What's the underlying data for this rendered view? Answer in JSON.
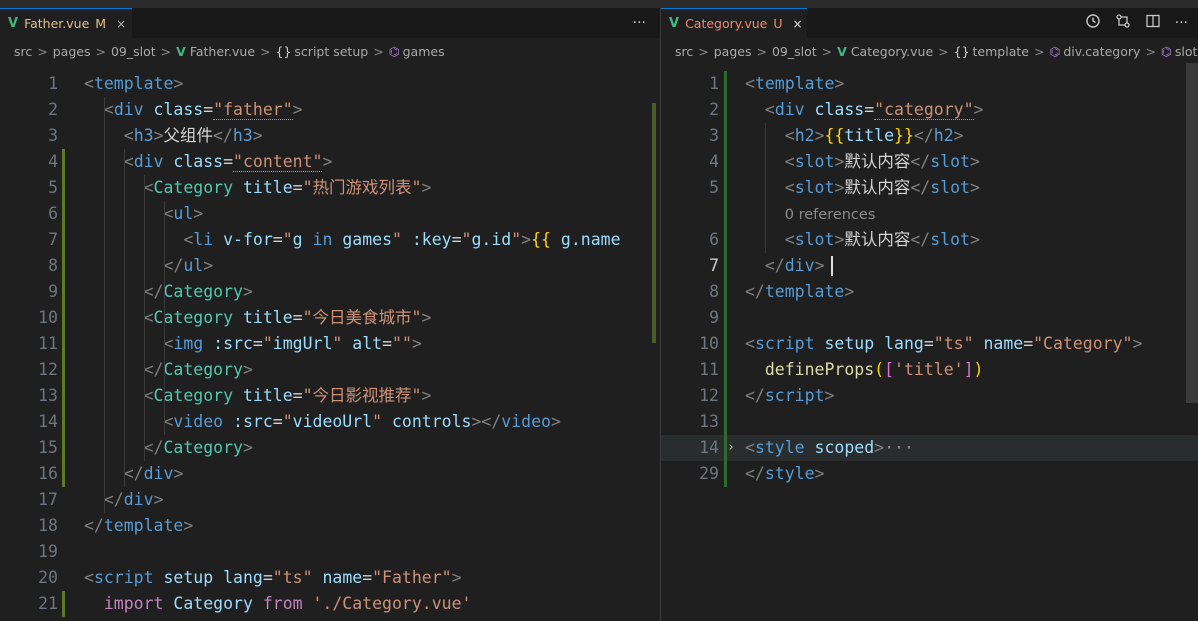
{
  "left": {
    "tab": {
      "name": "Father.vue",
      "flag": "M",
      "close": "×"
    },
    "actions": {
      "more": "···"
    },
    "breadcrumb": [
      "src",
      "pages",
      "09_slot",
      "Father.vue",
      "script setup",
      "games"
    ],
    "lines": [
      {
        "n": "1",
        "tokens": [
          [
            "<",
            "t-punc"
          ],
          [
            "template",
            "t-tag"
          ],
          [
            ">",
            "t-punc"
          ]
        ]
      },
      {
        "n": "2",
        "tokens": [
          [
            "  ",
            ""
          ],
          [
            "<",
            "t-punc"
          ],
          [
            "div",
            "t-tag"
          ],
          [
            " class",
            "t-attr"
          ],
          [
            "=",
            "t-txt"
          ],
          [
            "\"father\"",
            "t-str squiggle"
          ],
          [
            ">",
            "t-punc"
          ]
        ]
      },
      {
        "n": "3",
        "tokens": [
          [
            "    ",
            ""
          ],
          [
            "<",
            "t-punc"
          ],
          [
            "h3",
            "t-tag"
          ],
          [
            ">",
            "t-punc"
          ],
          [
            "父组件",
            "t-txt"
          ],
          [
            "</",
            "t-punc"
          ],
          [
            "h3",
            "t-tag"
          ],
          [
            ">",
            "t-punc"
          ]
        ]
      },
      {
        "n": "4",
        "tokens": [
          [
            "    ",
            ""
          ],
          [
            "<",
            "t-punc"
          ],
          [
            "div",
            "t-tag"
          ],
          [
            " class",
            "t-attr"
          ],
          [
            "=",
            "t-txt"
          ],
          [
            "\"content\"",
            "t-str squiggle"
          ],
          [
            ">",
            "t-punc"
          ]
        ]
      },
      {
        "n": "5",
        "tokens": [
          [
            "      ",
            ""
          ],
          [
            "<",
            "t-punc"
          ],
          [
            "Category",
            "t-comp"
          ],
          [
            " title",
            "t-attr"
          ],
          [
            "=",
            "t-txt"
          ],
          [
            "\"热门游戏列表\"",
            "t-str"
          ],
          [
            ">",
            "t-punc"
          ]
        ]
      },
      {
        "n": "6",
        "tokens": [
          [
            "        ",
            ""
          ],
          [
            "<",
            "t-punc"
          ],
          [
            "ul",
            "t-tag"
          ],
          [
            ">",
            "t-punc"
          ]
        ]
      },
      {
        "n": "7",
        "tokens": [
          [
            "          ",
            ""
          ],
          [
            "<",
            "t-punc"
          ],
          [
            "li",
            "t-tag"
          ],
          [
            " v-for",
            "t-attr"
          ],
          [
            "=",
            "t-txt"
          ],
          [
            "\"",
            "t-str"
          ],
          [
            "g",
            "t-attr"
          ],
          [
            " in ",
            "t-kw"
          ],
          [
            "games",
            "t-attr"
          ],
          [
            "\"",
            "t-str"
          ],
          [
            " :key",
            "t-attr"
          ],
          [
            "=",
            "t-txt"
          ],
          [
            "\"",
            "t-str"
          ],
          [
            "g.id",
            "t-attr"
          ],
          [
            "\"",
            "t-str"
          ],
          [
            ">",
            "t-punc"
          ],
          [
            "{{",
            "t-br1"
          ],
          [
            " g.name",
            "t-attr"
          ]
        ]
      },
      {
        "n": "8",
        "tokens": [
          [
            "        ",
            ""
          ],
          [
            "</",
            "t-punc"
          ],
          [
            "ul",
            "t-tag"
          ],
          [
            ">",
            "t-punc"
          ]
        ]
      },
      {
        "n": "9",
        "tokens": [
          [
            "      ",
            ""
          ],
          [
            "</",
            "t-punc"
          ],
          [
            "Category",
            "t-comp"
          ],
          [
            ">",
            "t-punc"
          ]
        ]
      },
      {
        "n": "10",
        "tokens": [
          [
            "      ",
            ""
          ],
          [
            "<",
            "t-punc"
          ],
          [
            "Category",
            "t-comp"
          ],
          [
            " title",
            "t-attr"
          ],
          [
            "=",
            "t-txt"
          ],
          [
            "\"今日美食城市\"",
            "t-str"
          ],
          [
            ">",
            "t-punc"
          ]
        ]
      },
      {
        "n": "11",
        "tokens": [
          [
            "        ",
            ""
          ],
          [
            "<",
            "t-punc"
          ],
          [
            "img",
            "t-tag"
          ],
          [
            " :src",
            "t-attr"
          ],
          [
            "=",
            "t-txt"
          ],
          [
            "\"",
            "t-str"
          ],
          [
            "imgUrl",
            "t-attr"
          ],
          [
            "\"",
            "t-str"
          ],
          [
            " alt",
            "t-attr"
          ],
          [
            "=",
            "t-txt"
          ],
          [
            "\"\"",
            "t-str"
          ],
          [
            ">",
            "t-punc"
          ]
        ]
      },
      {
        "n": "12",
        "tokens": [
          [
            "      ",
            ""
          ],
          [
            "</",
            "t-punc"
          ],
          [
            "Category",
            "t-comp"
          ],
          [
            ">",
            "t-punc"
          ]
        ]
      },
      {
        "n": "13",
        "tokens": [
          [
            "      ",
            ""
          ],
          [
            "<",
            "t-punc"
          ],
          [
            "Category",
            "t-comp"
          ],
          [
            " title",
            "t-attr"
          ],
          [
            "=",
            "t-txt"
          ],
          [
            "\"今日影视推荐\"",
            "t-str"
          ],
          [
            ">",
            "t-punc"
          ]
        ]
      },
      {
        "n": "14",
        "tokens": [
          [
            "        ",
            ""
          ],
          [
            "<",
            "t-punc"
          ],
          [
            "video",
            "t-tag"
          ],
          [
            " :src",
            "t-attr"
          ],
          [
            "=",
            "t-txt"
          ],
          [
            "\"",
            "t-str"
          ],
          [
            "videoUrl",
            "t-attr"
          ],
          [
            "\"",
            "t-str"
          ],
          [
            " controls",
            "t-attr"
          ],
          [
            "></",
            "t-punc"
          ],
          [
            "video",
            "t-tag"
          ],
          [
            ">",
            "t-punc"
          ]
        ]
      },
      {
        "n": "15",
        "tokens": [
          [
            "      ",
            ""
          ],
          [
            "</",
            "t-punc"
          ],
          [
            "Category",
            "t-comp"
          ],
          [
            ">",
            "t-punc"
          ]
        ]
      },
      {
        "n": "16",
        "tokens": [
          [
            "    ",
            ""
          ],
          [
            "</",
            "t-punc"
          ],
          [
            "div",
            "t-tag"
          ],
          [
            ">",
            "t-punc"
          ]
        ]
      },
      {
        "n": "17",
        "tokens": [
          [
            "  ",
            ""
          ],
          [
            "</",
            "t-punc"
          ],
          [
            "div",
            "t-tag"
          ],
          [
            ">",
            "t-punc"
          ]
        ]
      },
      {
        "n": "18",
        "tokens": [
          [
            "</",
            "t-punc"
          ],
          [
            "template",
            "t-tag"
          ],
          [
            ">",
            "t-punc"
          ]
        ]
      },
      {
        "n": "19",
        "tokens": []
      },
      {
        "n": "20",
        "tokens": [
          [
            "<",
            "t-punc"
          ],
          [
            "script",
            "t-tag"
          ],
          [
            " setup",
            "t-attr"
          ],
          [
            " lang",
            "t-attr"
          ],
          [
            "=",
            "t-txt"
          ],
          [
            "\"ts\"",
            "t-str"
          ],
          [
            " name",
            "t-attr"
          ],
          [
            "=",
            "t-txt"
          ],
          [
            "\"Father\"",
            "t-str"
          ],
          [
            ">",
            "t-punc"
          ]
        ]
      },
      {
        "n": "21",
        "tokens": [
          [
            "  ",
            ""
          ],
          [
            "import",
            "t-kw2"
          ],
          [
            " Category",
            "t-attr"
          ],
          [
            " from",
            "t-kw2"
          ],
          [
            " './Category.vue'",
            "t-str"
          ]
        ]
      }
    ]
  },
  "right": {
    "tab": {
      "name": "Category.vue",
      "flag": "U",
      "close": "×"
    },
    "breadcrumb": [
      "src",
      "pages",
      "09_slot",
      "Category.vue",
      "template",
      "div.category",
      "slot"
    ],
    "lines": [
      {
        "n": "1",
        "tokens": [
          [
            "<",
            "t-punc"
          ],
          [
            "template",
            "t-tag"
          ],
          [
            ">",
            "t-punc"
          ]
        ]
      },
      {
        "n": "2",
        "tokens": [
          [
            "  ",
            ""
          ],
          [
            "<",
            "t-punc"
          ],
          [
            "div",
            "t-tag"
          ],
          [
            " class",
            "t-attr"
          ],
          [
            "=",
            "t-txt"
          ],
          [
            "\"category\"",
            "t-str squiggle"
          ],
          [
            ">",
            "t-punc"
          ]
        ]
      },
      {
        "n": "3",
        "tokens": [
          [
            "    ",
            ""
          ],
          [
            "<",
            "t-punc"
          ],
          [
            "h2",
            "t-tag"
          ],
          [
            ">",
            "t-punc"
          ],
          [
            "{{",
            "t-br1"
          ],
          [
            "title",
            "t-attr"
          ],
          [
            "}}",
            "t-br1"
          ],
          [
            "</",
            "t-punc"
          ],
          [
            "h2",
            "t-tag"
          ],
          [
            ">",
            "t-punc"
          ]
        ]
      },
      {
        "n": "4",
        "tokens": [
          [
            "    ",
            ""
          ],
          [
            "<",
            "t-punc"
          ],
          [
            "slot",
            "t-tag"
          ],
          [
            ">",
            "t-punc"
          ],
          [
            "默认内容",
            "t-txt"
          ],
          [
            "</",
            "t-punc"
          ],
          [
            "slot",
            "t-tag"
          ],
          [
            ">",
            "t-punc"
          ]
        ]
      },
      {
        "n": "5",
        "tokens": [
          [
            "    ",
            ""
          ],
          [
            "<",
            "t-punc"
          ],
          [
            "slot",
            "t-tag"
          ],
          [
            ">",
            "t-punc"
          ],
          [
            "默认内容",
            "t-txt"
          ],
          [
            "</",
            "t-punc"
          ],
          [
            "slot",
            "t-tag"
          ],
          [
            ">",
            "t-punc"
          ]
        ]
      },
      {
        "n": "",
        "ref": true,
        "tokens": [
          [
            "    ",
            ""
          ],
          [
            "0 references",
            "t-ref"
          ]
        ]
      },
      {
        "n": "6",
        "tokens": [
          [
            "    ",
            ""
          ],
          [
            "<",
            "t-punc"
          ],
          [
            "slot",
            "t-tag"
          ],
          [
            ">",
            "t-punc"
          ],
          [
            "默认内容",
            "t-txt"
          ],
          [
            "</",
            "t-punc"
          ],
          [
            "slot",
            "t-tag"
          ],
          [
            ">",
            "t-punc"
          ]
        ]
      },
      {
        "n": "7",
        "current": true,
        "tokens": [
          [
            "  ",
            ""
          ],
          [
            "</",
            "t-punc"
          ],
          [
            "div",
            "t-tag"
          ],
          [
            ">",
            "t-punc"
          ]
        ]
      },
      {
        "n": "8",
        "tokens": [
          [
            "</",
            "t-punc"
          ],
          [
            "template",
            "t-tag"
          ],
          [
            ">",
            "t-punc"
          ]
        ]
      },
      {
        "n": "9",
        "tokens": []
      },
      {
        "n": "10",
        "tokens": [
          [
            "<",
            "t-punc"
          ],
          [
            "script",
            "t-tag"
          ],
          [
            " setup",
            "t-attr"
          ],
          [
            " lang",
            "t-attr"
          ],
          [
            "=",
            "t-txt"
          ],
          [
            "\"ts\"",
            "t-str"
          ],
          [
            " name",
            "t-attr"
          ],
          [
            "=",
            "t-txt"
          ],
          [
            "\"Category\"",
            "t-str"
          ],
          [
            ">",
            "t-punc"
          ]
        ]
      },
      {
        "n": "11",
        "tokens": [
          [
            "  ",
            ""
          ],
          [
            "defineProps",
            "t-fn"
          ],
          [
            "(",
            "t-br1"
          ],
          [
            "[",
            "t-br2"
          ],
          [
            "'title'",
            "t-str"
          ],
          [
            "]",
            "t-br2"
          ],
          [
            ")",
            "t-br1"
          ]
        ]
      },
      {
        "n": "12",
        "tokens": [
          [
            "</",
            "t-punc"
          ],
          [
            "script",
            "t-tag"
          ],
          [
            ">",
            "t-punc"
          ]
        ]
      },
      {
        "n": "13",
        "tokens": []
      },
      {
        "n": "14",
        "fold": true,
        "tokens": [
          [
            "<",
            "t-punc"
          ],
          [
            "style",
            "t-tag"
          ],
          [
            " scoped",
            "t-attr"
          ],
          [
            ">",
            "t-punc"
          ],
          [
            "···",
            "t-ellip"
          ]
        ]
      },
      {
        "n": "29",
        "tokens": [
          [
            "</",
            "t-punc"
          ],
          [
            "style",
            "t-tag"
          ],
          [
            ">",
            "t-punc"
          ]
        ]
      }
    ]
  }
}
